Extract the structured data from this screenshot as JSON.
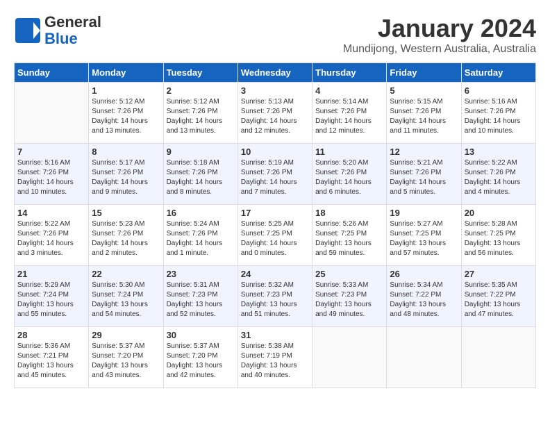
{
  "header": {
    "logo_line1": "General",
    "logo_line2": "Blue",
    "month": "January 2024",
    "location": "Mundijong, Western Australia, Australia"
  },
  "days_of_week": [
    "Sunday",
    "Monday",
    "Tuesday",
    "Wednesday",
    "Thursday",
    "Friday",
    "Saturday"
  ],
  "weeks": [
    [
      {
        "num": "",
        "info": ""
      },
      {
        "num": "1",
        "info": "Sunrise: 5:12 AM\nSunset: 7:26 PM\nDaylight: 14 hours\nand 13 minutes."
      },
      {
        "num": "2",
        "info": "Sunrise: 5:12 AM\nSunset: 7:26 PM\nDaylight: 14 hours\nand 13 minutes."
      },
      {
        "num": "3",
        "info": "Sunrise: 5:13 AM\nSunset: 7:26 PM\nDaylight: 14 hours\nand 12 minutes."
      },
      {
        "num": "4",
        "info": "Sunrise: 5:14 AM\nSunset: 7:26 PM\nDaylight: 14 hours\nand 12 minutes."
      },
      {
        "num": "5",
        "info": "Sunrise: 5:15 AM\nSunset: 7:26 PM\nDaylight: 14 hours\nand 11 minutes."
      },
      {
        "num": "6",
        "info": "Sunrise: 5:16 AM\nSunset: 7:26 PM\nDaylight: 14 hours\nand 10 minutes."
      }
    ],
    [
      {
        "num": "7",
        "info": "Sunrise: 5:16 AM\nSunset: 7:26 PM\nDaylight: 14 hours\nand 10 minutes."
      },
      {
        "num": "8",
        "info": "Sunrise: 5:17 AM\nSunset: 7:26 PM\nDaylight: 14 hours\nand 9 minutes."
      },
      {
        "num": "9",
        "info": "Sunrise: 5:18 AM\nSunset: 7:26 PM\nDaylight: 14 hours\nand 8 minutes."
      },
      {
        "num": "10",
        "info": "Sunrise: 5:19 AM\nSunset: 7:26 PM\nDaylight: 14 hours\nand 7 minutes."
      },
      {
        "num": "11",
        "info": "Sunrise: 5:20 AM\nSunset: 7:26 PM\nDaylight: 14 hours\nand 6 minutes."
      },
      {
        "num": "12",
        "info": "Sunrise: 5:21 AM\nSunset: 7:26 PM\nDaylight: 14 hours\nand 5 minutes."
      },
      {
        "num": "13",
        "info": "Sunrise: 5:22 AM\nSunset: 7:26 PM\nDaylight: 14 hours\nand 4 minutes."
      }
    ],
    [
      {
        "num": "14",
        "info": "Sunrise: 5:22 AM\nSunset: 7:26 PM\nDaylight: 14 hours\nand 3 minutes."
      },
      {
        "num": "15",
        "info": "Sunrise: 5:23 AM\nSunset: 7:26 PM\nDaylight: 14 hours\nand 2 minutes."
      },
      {
        "num": "16",
        "info": "Sunrise: 5:24 AM\nSunset: 7:26 PM\nDaylight: 14 hours\nand 1 minute."
      },
      {
        "num": "17",
        "info": "Sunrise: 5:25 AM\nSunset: 7:25 PM\nDaylight: 14 hours\nand 0 minutes."
      },
      {
        "num": "18",
        "info": "Sunrise: 5:26 AM\nSunset: 7:25 PM\nDaylight: 13 hours\nand 59 minutes."
      },
      {
        "num": "19",
        "info": "Sunrise: 5:27 AM\nSunset: 7:25 PM\nDaylight: 13 hours\nand 57 minutes."
      },
      {
        "num": "20",
        "info": "Sunrise: 5:28 AM\nSunset: 7:25 PM\nDaylight: 13 hours\nand 56 minutes."
      }
    ],
    [
      {
        "num": "21",
        "info": "Sunrise: 5:29 AM\nSunset: 7:24 PM\nDaylight: 13 hours\nand 55 minutes."
      },
      {
        "num": "22",
        "info": "Sunrise: 5:30 AM\nSunset: 7:24 PM\nDaylight: 13 hours\nand 54 minutes."
      },
      {
        "num": "23",
        "info": "Sunrise: 5:31 AM\nSunset: 7:23 PM\nDaylight: 13 hours\nand 52 minutes."
      },
      {
        "num": "24",
        "info": "Sunrise: 5:32 AM\nSunset: 7:23 PM\nDaylight: 13 hours\nand 51 minutes."
      },
      {
        "num": "25",
        "info": "Sunrise: 5:33 AM\nSunset: 7:23 PM\nDaylight: 13 hours\nand 49 minutes."
      },
      {
        "num": "26",
        "info": "Sunrise: 5:34 AM\nSunset: 7:22 PM\nDaylight: 13 hours\nand 48 minutes."
      },
      {
        "num": "27",
        "info": "Sunrise: 5:35 AM\nSunset: 7:22 PM\nDaylight: 13 hours\nand 47 minutes."
      }
    ],
    [
      {
        "num": "28",
        "info": "Sunrise: 5:36 AM\nSunset: 7:21 PM\nDaylight: 13 hours\nand 45 minutes."
      },
      {
        "num": "29",
        "info": "Sunrise: 5:37 AM\nSunset: 7:20 PM\nDaylight: 13 hours\nand 43 minutes."
      },
      {
        "num": "30",
        "info": "Sunrise: 5:37 AM\nSunset: 7:20 PM\nDaylight: 13 hours\nand 42 minutes."
      },
      {
        "num": "31",
        "info": "Sunrise: 5:38 AM\nSunset: 7:19 PM\nDaylight: 13 hours\nand 40 minutes."
      },
      {
        "num": "",
        "info": ""
      },
      {
        "num": "",
        "info": ""
      },
      {
        "num": "",
        "info": ""
      }
    ]
  ]
}
